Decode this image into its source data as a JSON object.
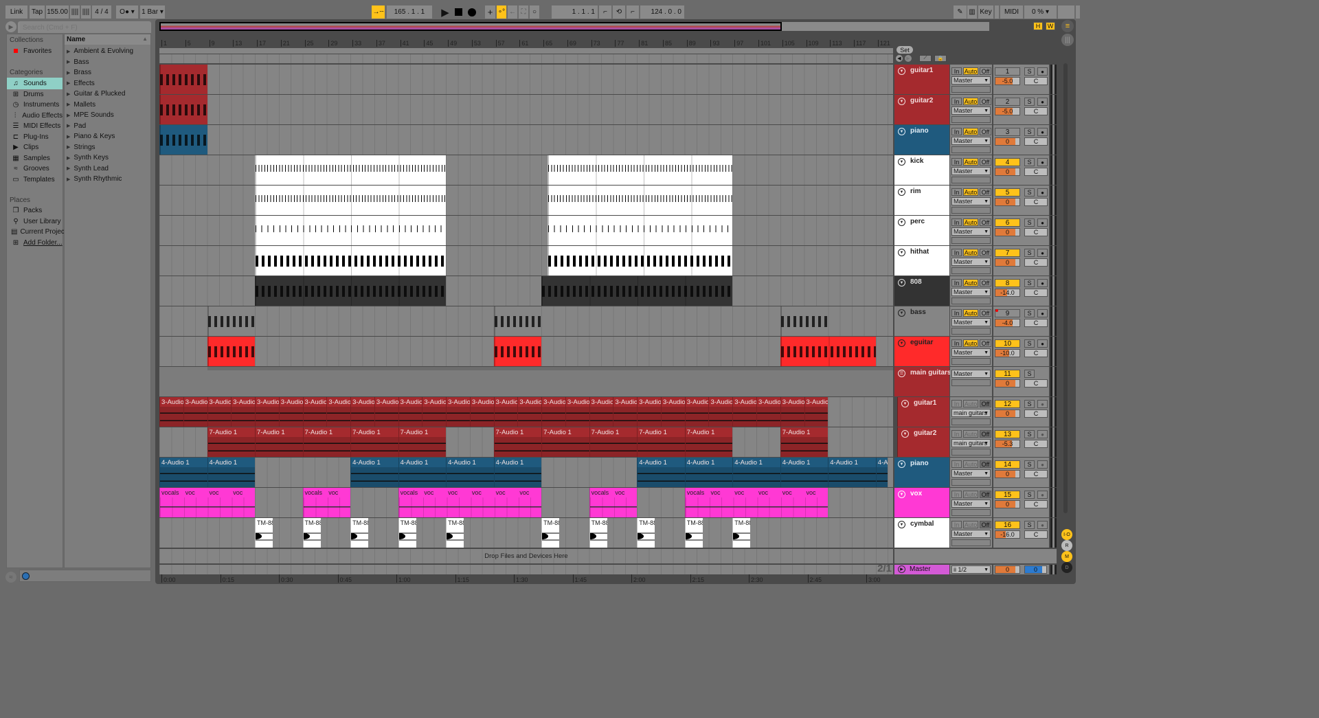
{
  "toolbar": {
    "link": "Link",
    "tap": "Tap",
    "tempo": "155.00",
    "signature": "4 / 4",
    "metronome": "O●",
    "quantize": "1 Bar",
    "position": "165 .  1 .  1",
    "loop_start": "1 .  1 .  1",
    "loop_length": "124 .  0 .  0",
    "key": "Key",
    "midi": "MIDI",
    "cpu": "0 %"
  },
  "browser": {
    "search_placeholder": "Search (Cmd + F)",
    "collections_label": "Collections",
    "favorites": "Favorites",
    "categories_label": "Categories",
    "categories": [
      {
        "label": "Sounds",
        "icon": "♫"
      },
      {
        "label": "Drums",
        "icon": "⊞"
      },
      {
        "label": "Instruments",
        "icon": "◷"
      },
      {
        "label": "Audio Effects",
        "icon": "⫶"
      },
      {
        "label": "MIDI Effects",
        "icon": "☰"
      },
      {
        "label": "Plug-Ins",
        "icon": "⊏"
      },
      {
        "label": "Clips",
        "icon": "▶"
      },
      {
        "label": "Samples",
        "icon": "▦"
      },
      {
        "label": "Grooves",
        "icon": "≈"
      },
      {
        "label": "Templates",
        "icon": "▭"
      }
    ],
    "places_label": "Places",
    "places": [
      {
        "label": "Packs",
        "icon": "❐"
      },
      {
        "label": "User Library",
        "icon": "⚲"
      },
      {
        "label": "Current Projec",
        "icon": "▤"
      },
      {
        "label": "Add Folder...",
        "icon": "⊞"
      }
    ],
    "name_header": "Name",
    "items": [
      "Ambient & Evolving",
      "Bass",
      "Brass",
      "Effects",
      "Guitar & Plucked",
      "Mallets",
      "MPE Sounds",
      "Pad",
      "Piano & Keys",
      "Strings",
      "Synth Keys",
      "Synth Lead",
      "Synth Rhythmic"
    ]
  },
  "arrangement": {
    "set_label": "Set",
    "h_label": "H",
    "w_label": "W",
    "drop_hint": "Drop Files and Devices Here",
    "time_sig_display": "2/1",
    "bar_ticks": [
      "1",
      "5",
      "9",
      "13",
      "17",
      "21",
      "25",
      "29",
      "33",
      "37",
      "41",
      "45",
      "49",
      "53",
      "57",
      "61",
      "65",
      "69",
      "73",
      "77",
      "81",
      "85",
      "89",
      "93",
      "97",
      "101",
      "105",
      "109",
      "113",
      "117",
      "121"
    ],
    "time_ticks": [
      "0:00",
      "0:15",
      "0:30",
      "0:45",
      "1:00",
      "1:15",
      "1:30",
      "1:45",
      "2:00",
      "2:15",
      "2:30",
      "2:45",
      "3:00"
    ]
  },
  "tracks": [
    {
      "name": "guitar1",
      "color": "#a52a2e",
      "text": "#f3dede",
      "num": "1",
      "num_on": false,
      "vol": "-5.0",
      "out": "Master",
      "mode": "auto",
      "clips": [
        {
          "s": 1,
          "e": 9,
          "type": "midi"
        }
      ]
    },
    {
      "name": "guitar2",
      "color": "#a52a2e",
      "text": "#f3dede",
      "num": "2",
      "num_on": false,
      "vol": "-5.0",
      "out": "Master",
      "mode": "auto",
      "clips": [
        {
          "s": 1,
          "e": 9,
          "type": "midi"
        }
      ]
    },
    {
      "name": "piano",
      "color": "#1f5a7e",
      "text": "#e0ecf5",
      "num": "3",
      "num_on": false,
      "vol": "0",
      "out": "Master",
      "mode": "auto",
      "clips": [
        {
          "s": 1,
          "e": 9,
          "type": "midi"
        }
      ]
    },
    {
      "name": "kick",
      "color": "#ffffff",
      "text": "#222",
      "num": "4",
      "num_on": true,
      "vol": "0",
      "out": "Master",
      "mode": "auto",
      "clips": [
        {
          "s": 17,
          "e": 49,
          "type": "drum"
        },
        {
          "s": 66,
          "e": 97,
          "type": "drum"
        }
      ]
    },
    {
      "name": "rim",
      "color": "#ffffff",
      "text": "#222",
      "num": "5",
      "num_on": true,
      "vol": "0",
      "out": "Master",
      "mode": "auto",
      "clips": [
        {
          "s": 17,
          "e": 49,
          "type": "drum"
        },
        {
          "s": 66,
          "e": 97,
          "type": "drum"
        }
      ]
    },
    {
      "name": "perc",
      "color": "#ffffff",
      "text": "#222",
      "num": "6",
      "num_on": true,
      "vol": "0",
      "out": "Master",
      "mode": "auto",
      "clips": [
        {
          "s": 17,
          "e": 49,
          "type": "drum2"
        },
        {
          "s": 66,
          "e": 97,
          "type": "drum2"
        }
      ]
    },
    {
      "name": "hithat",
      "color": "#ffffff",
      "text": "#222",
      "num": "7",
      "num_on": true,
      "vol": "0",
      "out": "Master",
      "mode": "auto",
      "clips": [
        {
          "s": 17,
          "e": 49,
          "type": "midi"
        },
        {
          "s": 66,
          "e": 97,
          "type": "midi"
        }
      ]
    },
    {
      "name": "808",
      "color": "#333333",
      "text": "#ddd",
      "num": "8",
      "num_on": true,
      "vol": "-14.0",
      "out": "Master",
      "mode": "auto",
      "clips": [
        {
          "s": 17,
          "e": 49,
          "type": "midi"
        },
        {
          "s": 65,
          "e": 97,
          "type": "midi"
        }
      ]
    },
    {
      "name": "bass",
      "color": "#858585",
      "text": "#222",
      "num": "9",
      "num_on": false,
      "vol": "-4.0",
      "out": "Master",
      "mode": "auto",
      "clips": [
        {
          "s": 9,
          "e": 17,
          "type": "midi"
        },
        {
          "s": 57,
          "e": 65,
          "type": "midi"
        },
        {
          "s": 105,
          "e": 113,
          "type": "midi"
        }
      ]
    },
    {
      "name": "eguitar",
      "color": "#ff2a2a",
      "text": "#222",
      "num": "10",
      "num_on": true,
      "vol": "-10.0",
      "out": "Master",
      "mode": "auto",
      "clips": [
        {
          "s": 9,
          "e": 17,
          "type": "midi"
        },
        {
          "s": 57,
          "e": 65,
          "type": "midi"
        },
        {
          "s": 105,
          "e": 121,
          "type": "midi"
        }
      ]
    },
    {
      "name": "main guitars",
      "color": "#a52a2e",
      "text": "#f3dede",
      "num": "11",
      "num_on": true,
      "vol": "0",
      "out": "Master",
      "mode": "group",
      "clips": []
    },
    {
      "name": "guitar1",
      "color": "#a52a2e",
      "text": "#f3dede",
      "num": "12",
      "num_on": true,
      "vol": "0",
      "out": "main guitars",
      "mode": "off",
      "clips": [
        {
          "s": 1,
          "e": 113,
          "type": "audio",
          "label": "3-Audio",
          "every": 4
        }
      ]
    },
    {
      "name": "guitar2",
      "color": "#a52a2e",
      "text": "#f3dede",
      "num": "13",
      "num_on": true,
      "vol": "-5.3",
      "out": "main guitars",
      "mode": "off",
      "clips": [
        {
          "s": 9,
          "e": 49,
          "type": "audio",
          "label": "7-Audio 1",
          "every": 8
        },
        {
          "s": 57,
          "e": 97,
          "type": "audio",
          "label": "7-Audio 1",
          "every": 8
        },
        {
          "s": 105,
          "e": 113,
          "type": "audio",
          "label": "7-Audio 1",
          "every": 8
        }
      ]
    },
    {
      "name": "piano",
      "color": "#1f5a7e",
      "text": "#e0ecf5",
      "num": "14",
      "num_on": true,
      "vol": "0",
      "out": "Master",
      "mode": "off",
      "clips": [
        {
          "s": 1,
          "e": 17,
          "type": "audio",
          "label": "4-Audio 1",
          "every": 8
        },
        {
          "s": 33,
          "e": 65,
          "type": "audio",
          "label": "4-Audio 1",
          "every": 8
        },
        {
          "s": 81,
          "e": 123,
          "type": "audio",
          "label": "4-Audio 1",
          "every": 8
        }
      ]
    },
    {
      "name": "vox",
      "color": "#ff39d4",
      "text": "#fff",
      "num": "15",
      "num_on": true,
      "vol": "0",
      "out": "Master",
      "mode": "off",
      "clips": [
        {
          "s": 1,
          "e": 17,
          "type": "vocal"
        },
        {
          "s": 25,
          "e": 33,
          "type": "vocal"
        },
        {
          "s": 41,
          "e": 65,
          "type": "vocal"
        },
        {
          "s": 73,
          "e": 81,
          "type": "vocal"
        },
        {
          "s": 89,
          "e": 113,
          "type": "vocal"
        }
      ]
    },
    {
      "name": "cymbal",
      "color": "#ffffff",
      "text": "#222",
      "num": "16",
      "num_on": true,
      "vol": "-16.0",
      "out": "Master",
      "mode": "off",
      "clips": [
        {
          "s": 17,
          "e": 20,
          "type": "oneshot",
          "label": "TM-88"
        },
        {
          "s": 25,
          "e": 28,
          "type": "oneshot",
          "label": "TM-88"
        },
        {
          "s": 33,
          "e": 36,
          "type": "oneshot",
          "label": "TM-88"
        },
        {
          "s": 41,
          "e": 44,
          "type": "oneshot",
          "label": "TM-88"
        },
        {
          "s": 49,
          "e": 52,
          "type": "oneshot",
          "label": "TM-88"
        },
        {
          "s": 65,
          "e": 68,
          "type": "oneshot",
          "label": "TM-88"
        },
        {
          "s": 73,
          "e": 76,
          "type": "oneshot",
          "label": "TM-88"
        },
        {
          "s": 81,
          "e": 84,
          "type": "oneshot",
          "label": "TM-88"
        },
        {
          "s": 89,
          "e": 92,
          "type": "oneshot",
          "label": "TM-88"
        },
        {
          "s": 97,
          "e": 100,
          "type": "oneshot",
          "label": "TM-88"
        }
      ]
    }
  ],
  "vocal_labels": [
    "vocals",
    "voc",
    "voc"
  ],
  "io_labels": {
    "in": "In",
    "auto": "Auto",
    "off": "Off",
    "solo": "S",
    "pan": "C"
  },
  "master": {
    "name": "Master",
    "output": "ii 1/2",
    "volume": "0",
    "cue": "0"
  },
  "side": {
    "io": "I·O",
    "r": "R",
    "m": "M",
    "d": "D"
  }
}
